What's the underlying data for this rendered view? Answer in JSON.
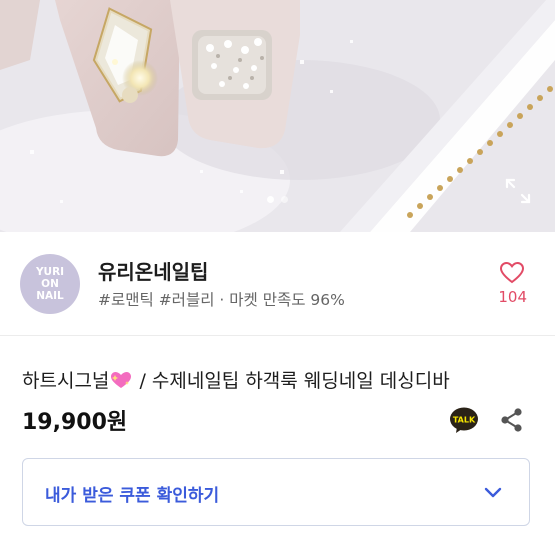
{
  "hero": {
    "slide_count": 2,
    "active_slide": 1,
    "expand_icon": "expand-icon"
  },
  "shop": {
    "avatar_lines": [
      "YURI",
      "ON",
      "NAIL"
    ],
    "name": "유리온네일팁",
    "tags": "#로맨틱 #러블리 · 마켓 만족도 96%",
    "like_count": "104",
    "like_icon": "heart-outline-icon",
    "accent_color": "#e24b66"
  },
  "product": {
    "title_prefix": "하트시그널",
    "title_suffix": " / 수제네일팁 하객룩 웨딩네일 데싱디바",
    "title_emoji": "sparkling-heart-icon",
    "price": "19,900원",
    "talk_label": "TALK",
    "share_icon": "share-icon"
  },
  "coupon": {
    "label": "내가 받은 쿠폰 확인하기",
    "accent_color": "#3b5bdb",
    "chevron_icon": "chevron-down-icon"
  }
}
